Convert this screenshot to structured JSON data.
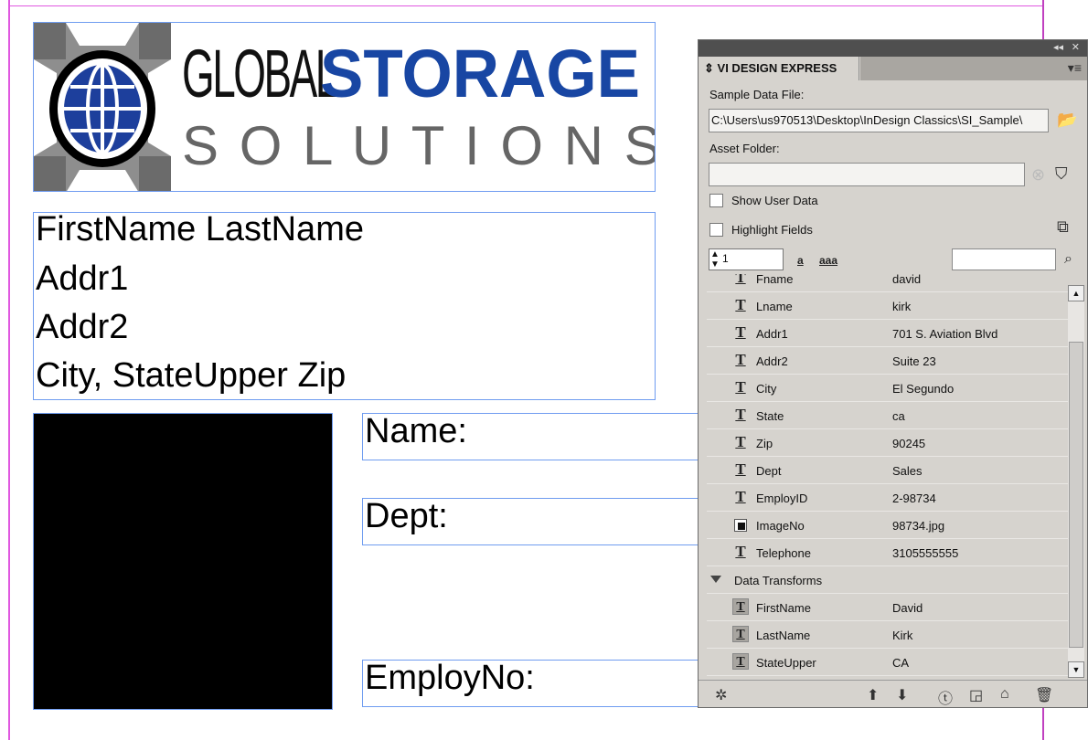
{
  "document": {
    "logo": {
      "word1": "GLOBAL",
      "word2": "STORAGE",
      "word3": "S O L U T I O N S"
    },
    "address_lines": [
      "FirstName LastName",
      "Addr1",
      "Addr2",
      "City, StateUpper Zip"
    ],
    "labels": {
      "name": "Name:",
      "dept": "Dept:",
      "employ": "EmployNo:"
    }
  },
  "panel": {
    "title": "VI DESIGN EXPRESS",
    "sample_data_label": "Sample Data File:",
    "sample_data_value": "C:\\Users\\us970513\\Desktop\\InDesign Classics\\SI_Sample\\",
    "asset_folder_label": "Asset Folder:",
    "asset_folder_value": "",
    "show_user_data": "Show User Data",
    "highlight_fields": "Highlight Fields",
    "record_number": "1",
    "case_lower": "a",
    "case_all": "aaa",
    "search_value": "",
    "fields": [
      {
        "name": "Fname",
        "value": "david",
        "icon": "text-field-icon"
      },
      {
        "name": "Lname",
        "value": "kirk",
        "icon": "text-field-icon"
      },
      {
        "name": "Addr1",
        "value": "701 S. Aviation Blvd",
        "icon": "text-field-icon"
      },
      {
        "name": "Addr2",
        "value": "Suite 23",
        "icon": "text-field-icon"
      },
      {
        "name": "City",
        "value": "El Segundo",
        "icon": "text-field-icon"
      },
      {
        "name": "State",
        "value": "ca",
        "icon": "text-field-icon"
      },
      {
        "name": "Zip",
        "value": "90245",
        "icon": "text-field-icon"
      },
      {
        "name": "Dept",
        "value": "Sales",
        "icon": "text-field-icon"
      },
      {
        "name": "EmployID",
        "value": "2-98734",
        "icon": "text-field-icon"
      },
      {
        "name": "ImageNo",
        "value": "98734.jpg",
        "icon": "image-field-icon"
      },
      {
        "name": "Telephone",
        "value": "3105555555",
        "icon": "text-field-icon"
      }
    ],
    "section_label": "Data Transforms",
    "transforms": [
      {
        "name": "FirstName",
        "value": "David"
      },
      {
        "name": "LastName",
        "value": "Kirk"
      },
      {
        "name": "StateUpper",
        "value": "CA"
      }
    ]
  }
}
